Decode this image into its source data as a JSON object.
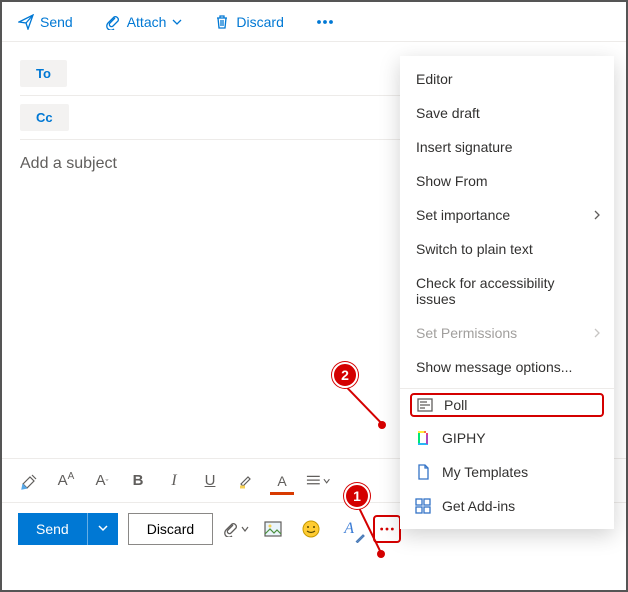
{
  "toolbar": {
    "send": "Send",
    "attach": "Attach",
    "discard": "Discard"
  },
  "compose": {
    "to_label": "To",
    "cc_label": "Cc",
    "subject_placeholder": "Add a subject"
  },
  "format": {
    "bold": "B",
    "italic": "I",
    "underline": "U",
    "font_letter": "A"
  },
  "bottom": {
    "send": "Send",
    "discard": "Discard"
  },
  "menu": {
    "editor": "Editor",
    "save_draft": "Save draft",
    "insert_signature": "Insert signature",
    "show_from": "Show From",
    "set_importance": "Set importance",
    "switch_plain": "Switch to plain text",
    "accessibility": "Check for accessibility issues",
    "set_permissions": "Set Permissions",
    "show_options": "Show message options...",
    "poll": "Poll",
    "giphy": "GIPHY",
    "my_templates": "My Templates",
    "get_addins": "Get Add-ins"
  },
  "callouts": {
    "one": "1",
    "two": "2"
  }
}
